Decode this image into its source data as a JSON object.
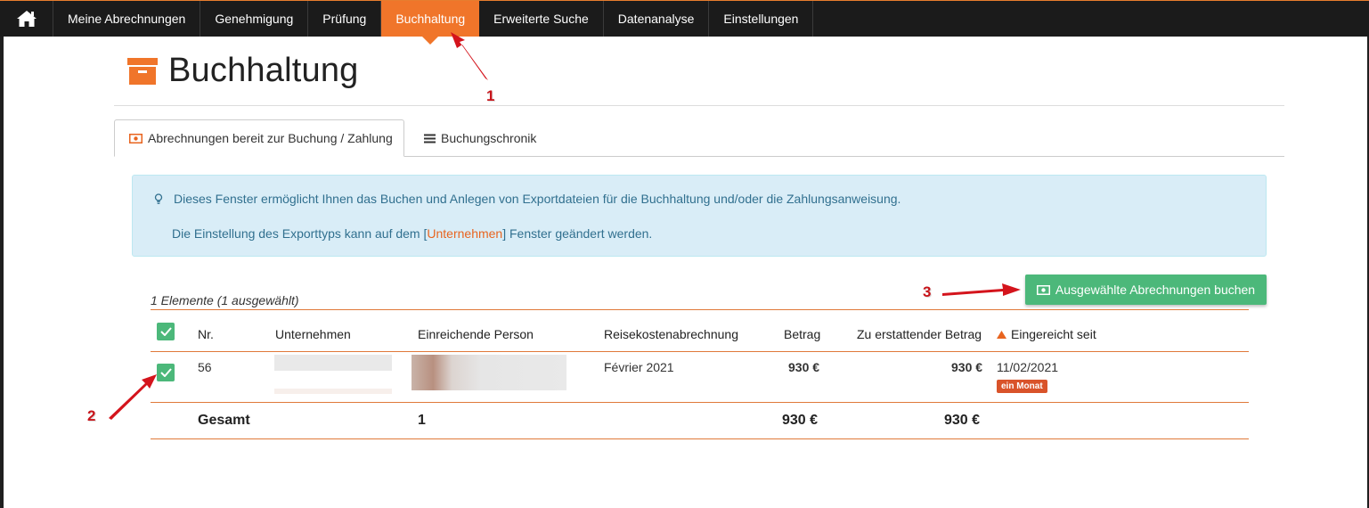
{
  "nav": {
    "items": [
      "Meine Abrechnungen",
      "Genehmigung",
      "Prüfung",
      "Buchhaltung",
      "Erweiterte Suche",
      "Datenanalyse",
      "Einstellungen"
    ],
    "active_index": 3
  },
  "page": {
    "title": "Buchhaltung"
  },
  "tabs": [
    {
      "label": "Abrechnungen bereit zur Buchung / Zahlung",
      "icon": "money-icon"
    },
    {
      "label": "Buchungschronik",
      "icon": "list-icon"
    }
  ],
  "info": {
    "line1": "Dieses Fenster ermöglicht Ihnen das Buchen und Anlegen von Exportdateien für die Buchhaltung und/oder die Zahlungsanweisung.",
    "line2_before": "Die Einstellung des Exporttyps kann auf dem [",
    "line2_link": "Unternehmen",
    "line2_after": "] Fenster geändert werden."
  },
  "count": "1 Elemente (1 ausgewählt)",
  "book_button": "Ausgewählte Abrechnungen buchen",
  "table": {
    "headers": [
      "Nr.",
      "Unternehmen",
      "Einreichende Person",
      "Reisekostenabrechnung",
      "Betrag",
      "Zu erstattender Betrag",
      "Eingereicht seit"
    ],
    "rows": [
      {
        "nr": "56",
        "report": "Février 2021",
        "amount": "930 €",
        "refund": "930 €",
        "submitted": "11/02/2021",
        "age_badge": "ein Monat"
      }
    ],
    "total": {
      "label": "Gesamt",
      "count": "1",
      "amount": "930 €",
      "refund": "930 €"
    }
  },
  "annotations": [
    "1",
    "2",
    "3"
  ],
  "colors": {
    "accent": "#f0752a",
    "nav_bg": "#1b1b1b",
    "success": "#4cb87a",
    "info_bg": "#d9edf7",
    "badge": "#d9532a"
  }
}
